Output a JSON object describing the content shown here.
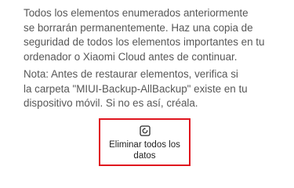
{
  "warning": {
    "lines": [
      "Todos los elementos enumerados anteriormente",
      "se borrarán permanentemente. Haz una copia de",
      "seguridad de todos los elementos importantes en tu",
      "ordenador o Xiaomi Cloud antes de continuar."
    ]
  },
  "note": {
    "lines": [
      "Nota: Antes de restaurar elementos, verifica si",
      "la carpeta \"MIUI-Backup-AllBackup\" existe en tu",
      "dispositivo móvil. Si no es así, créala."
    ]
  },
  "action": {
    "icon": "restore-icon",
    "label_lines": [
      "Eliminar todos los",
      "datos"
    ],
    "highlight_color": "#e0141e"
  }
}
